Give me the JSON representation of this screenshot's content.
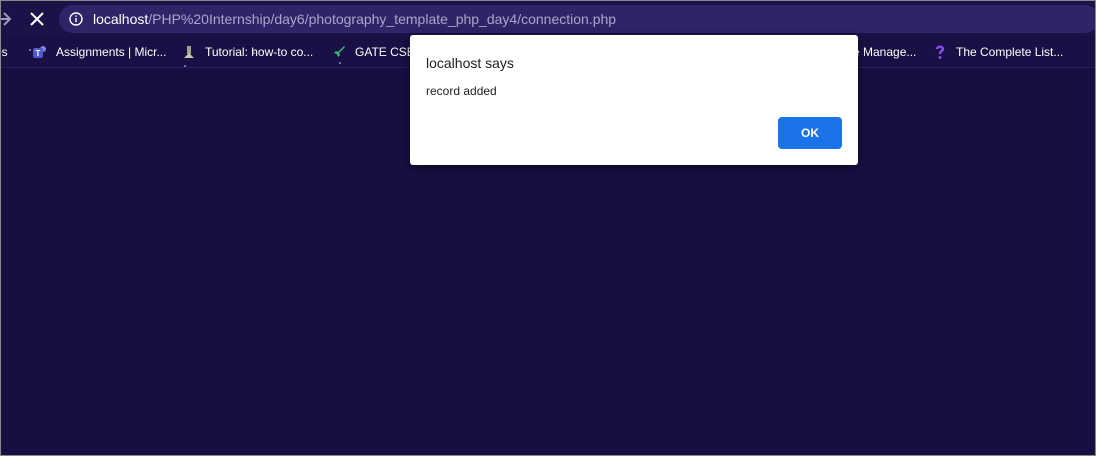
{
  "browser": {
    "url_host": "localhost",
    "url_path": "/PHP%20Internship/day6/photography_template_php_day4/connection.php",
    "forward_icon": "arrow-right-icon",
    "stop_icon": "close-icon",
    "info_icon": "info-icon"
  },
  "bookmarks": {
    "items": [
      {
        "label": "ps",
        "icon": "none"
      },
      {
        "label": "Assignments | Micr...",
        "icon": "teams-icon"
      },
      {
        "label": "Tutorial: how-to co...",
        "icon": "tutorial-icon"
      },
      {
        "label": "GATE CSE",
        "icon": "rocket-icon"
      },
      {
        "label": "e Manage...",
        "icon": "none"
      },
      {
        "label": "The Complete List...",
        "icon": "question-icon"
      }
    ]
  },
  "dialog": {
    "title": "localhost says",
    "message": "record added",
    "ok_label": "OK"
  },
  "colors": {
    "page_background": "#180e42",
    "omnibox": "#2e2467",
    "accent": "#1a73e8"
  }
}
